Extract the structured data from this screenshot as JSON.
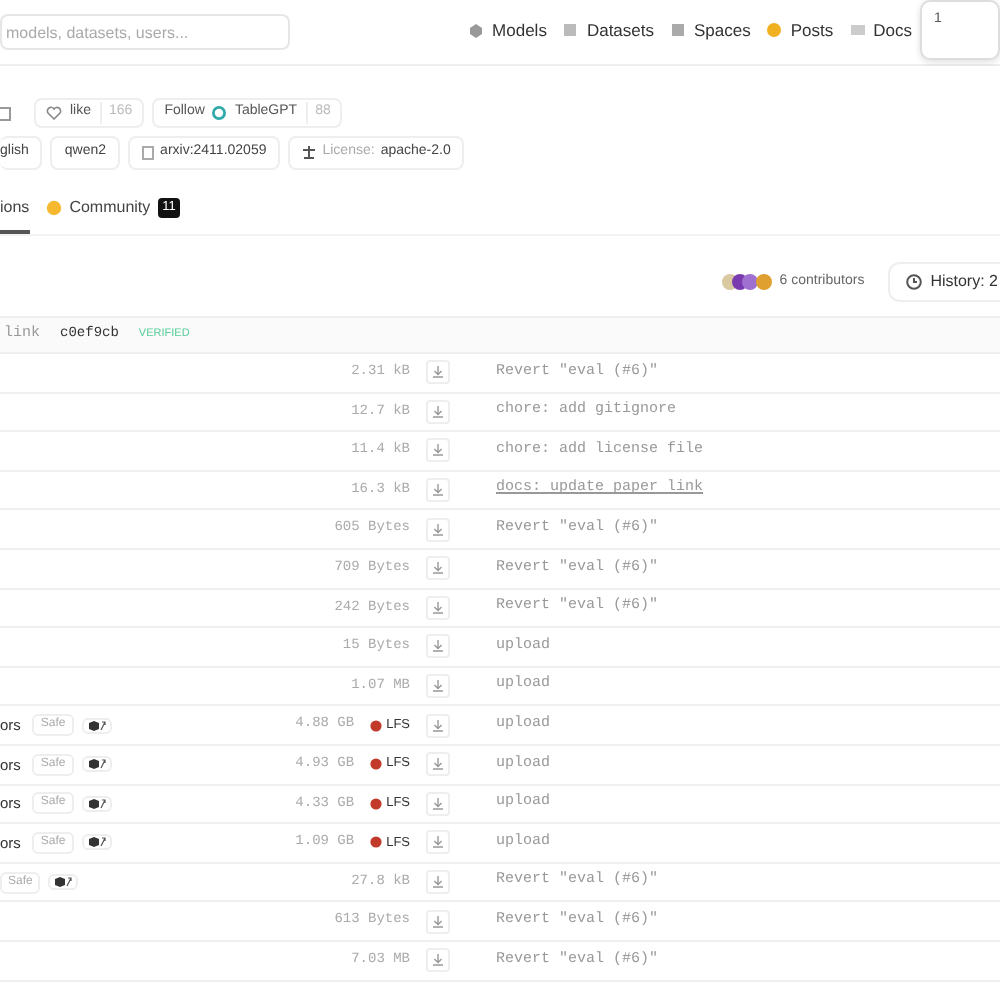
{
  "header": {
    "search": {
      "placeholder": "models, datasets, users..."
    },
    "nav": [
      {
        "label": "Models"
      },
      {
        "label": "Datasets"
      },
      {
        "label": "Spaces"
      },
      {
        "label": "Posts"
      },
      {
        "label": "Docs"
      }
    ],
    "menu_text": "1"
  },
  "actions": {
    "like_label": "like",
    "like_count": "166",
    "follow_label": "Follow",
    "org": "TableGPT",
    "follow_count": "88"
  },
  "tags": [
    {
      "label": "glish",
      "kind": "plain"
    },
    {
      "label": "qwen2",
      "kind": "plain"
    },
    {
      "label": "arxiv:2411.02059",
      "kind": "paper"
    },
    {
      "label": "apache-2.0",
      "kind": "license",
      "prefix": "License:"
    }
  ],
  "tabs": [
    {
      "label": "ions",
      "selected": true
    },
    {
      "label": "Community",
      "selected": false,
      "count": "11"
    }
  ],
  "contributors": {
    "text": "6 contributors",
    "history": "History: 2"
  },
  "commit": {
    "message": "link",
    "hash": "c0ef9cb",
    "status": "VERIFIED"
  },
  "files": [
    {
      "size": "2.31 kB",
      "lfs": false,
      "message": "Revert \"eval (#6)\"",
      "link": false
    },
    {
      "size": "12.7 kB",
      "lfs": false,
      "message": "chore: add gitignore",
      "link": false
    },
    {
      "size": "11.4 kB",
      "lfs": false,
      "message": "chore: add license file",
      "link": false
    },
    {
      "size": "16.3 kB",
      "lfs": false,
      "message": "docs: update paper link",
      "link": true
    },
    {
      "size": "605 Bytes",
      "lfs": false,
      "message": "Revert \"eval (#6)\"",
      "link": false
    },
    {
      "size": "709 Bytes",
      "lfs": false,
      "message": "Revert \"eval (#6)\"",
      "link": false
    },
    {
      "size": "242 Bytes",
      "lfs": false,
      "message": "Revert \"eval (#6)\"",
      "link": false
    },
    {
      "size": "15 Bytes",
      "lfs": false,
      "message": "upload",
      "link": false
    },
    {
      "size": "1.07 MB",
      "lfs": false,
      "message": "upload",
      "link": false
    },
    {
      "name": "ors",
      "badge": "Safe",
      "size": "4.88 GB",
      "lfs": true,
      "lfs_label": "LFS",
      "message": "upload",
      "link": false
    },
    {
      "name": "ors",
      "badge": "Safe",
      "size": "4.93 GB",
      "lfs": true,
      "lfs_label": "LFS",
      "message": "upload",
      "link": false
    },
    {
      "name": "ors",
      "badge": "Safe",
      "size": "4.33 GB",
      "lfs": true,
      "lfs_label": "LFS",
      "message": "upload",
      "link": false
    },
    {
      "name": "ors",
      "badge": "Safe",
      "size": "1.09 GB",
      "lfs": true,
      "lfs_label": "LFS",
      "message": "upload",
      "link": false
    },
    {
      "badge": "Safe",
      "size": "27.8 kB",
      "lfs": false,
      "message": "Revert \"eval (#6)\"",
      "link": false
    },
    {
      "size": "613 Bytes",
      "lfs": false,
      "message": "Revert \"eval (#6)\"",
      "link": false
    },
    {
      "size": "7.03 MB",
      "lfs": false,
      "message": "Revert \"eval (#6)\"",
      "link": false
    }
  ]
}
